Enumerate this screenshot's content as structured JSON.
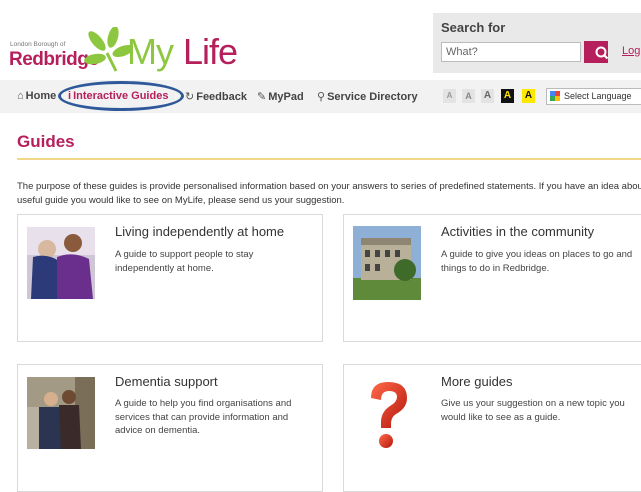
{
  "header": {
    "logo": {
      "council_small": "London Borough of",
      "council": "Redbridge",
      "brand_my": "My",
      "brand_life": "Life"
    },
    "search": {
      "label": "Search for",
      "placeholder": "What?"
    },
    "login_label": "Log"
  },
  "nav": {
    "items": [
      {
        "label": "Home",
        "icon": "home-icon"
      },
      {
        "label": "Interactive Guides",
        "icon": "info-icon",
        "active": true
      },
      {
        "label": "Feedback",
        "icon": "refresh-icon"
      },
      {
        "label": "MyPad",
        "icon": "edit-icon"
      },
      {
        "label": "Service Directory",
        "icon": "map-marker-icon"
      }
    ],
    "text_size_options": [
      "A",
      "A",
      "A",
      "A",
      "A"
    ],
    "language_label": "Select Language"
  },
  "main": {
    "title": "Guides",
    "intro": "The purpose of these guides is provide personalised information based on your answers to series of predefined statements. If you have an idea about a useful guide you would like to see on MyLife, please send us your suggestion.",
    "cards": [
      {
        "title": "Living independently at home",
        "description": "A guide to support people to stay independently at home."
      },
      {
        "title": "Activities in the community",
        "description": "A guide to give you ideas on places to go and things to do in Redbridge."
      },
      {
        "title": "Dementia support",
        "description": "A guide to help you find organisations and services that can provide information and advice on dementia."
      },
      {
        "title": "More guides",
        "description": "Give us your suggestion on a new topic you would like to see as a guide."
      }
    ]
  },
  "colors": {
    "brand": "#b51f5c",
    "accent_green": "#8dc63f",
    "rule": "#f0d78a",
    "highlight_ring": "#2e5899"
  }
}
